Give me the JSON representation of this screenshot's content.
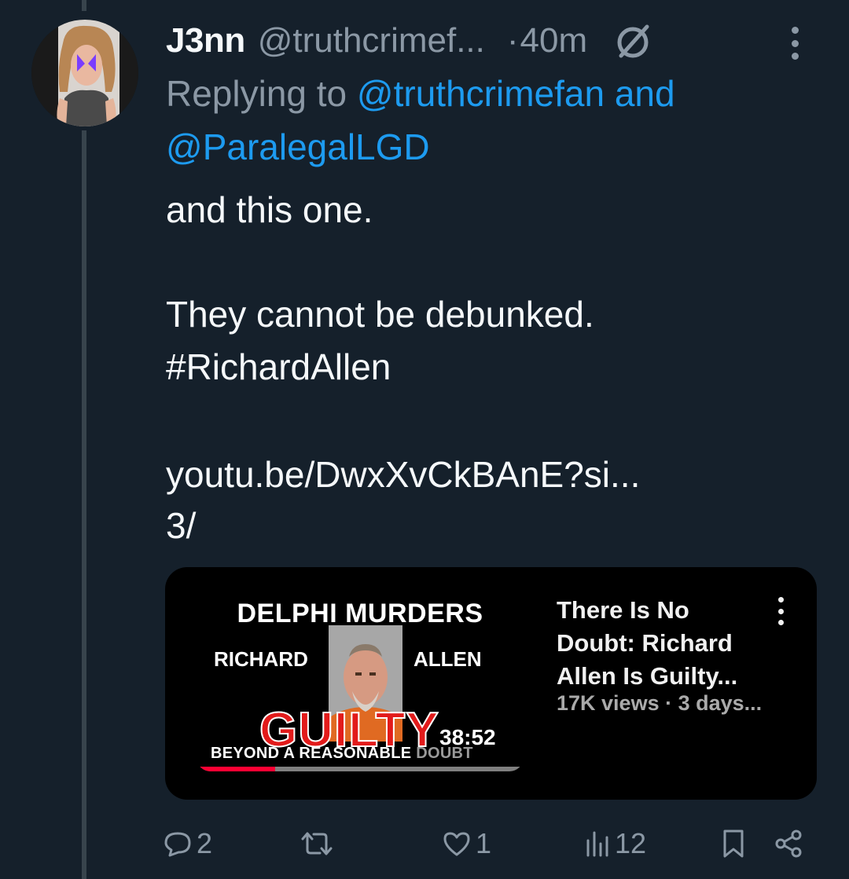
{
  "tweet": {
    "display_name": "J3nn",
    "handle": "@truthcrimef...",
    "separator": "·",
    "time": "40m",
    "reply_prefix": "Replying to",
    "reply_user1": "@truthcrimefan",
    "reply_and": "and",
    "reply_user2": "@ParalegalLGD",
    "line1": "and this one.",
    "line2": "They cannot be debunked.",
    "hashtag": "#RichardAllen",
    "link": "youtu.be/DwxXvCkBAnE?si...",
    "thread_marker": "3/"
  },
  "video_card": {
    "thumb_title": "DELPHI MURDERS",
    "thumb_left": "RICHARD",
    "thumb_right": "ALLEN",
    "thumb_headline": "GUILTY",
    "thumb_footer": "BEYOND A REASONABLE",
    "thumb_footer_faded": "DOUBT",
    "duration": "38:52",
    "watched_fraction": 0.24,
    "title": "There Is No Doubt: Richard Allen Is Guilty...",
    "meta": "17K views · 3 days..."
  },
  "actions": {
    "replies": "2",
    "reposts": "",
    "likes": "1",
    "views": "12"
  },
  "icons": [
    "mute-icon",
    "more-options-icon",
    "reply-icon",
    "repost-icon",
    "like-icon",
    "views-icon",
    "bookmark-icon",
    "share-icon"
  ],
  "colors": {
    "background": "#15202b",
    "link": "#1d9bf0",
    "muted_text": "#8b98a5",
    "thread_line": "#38444d"
  }
}
